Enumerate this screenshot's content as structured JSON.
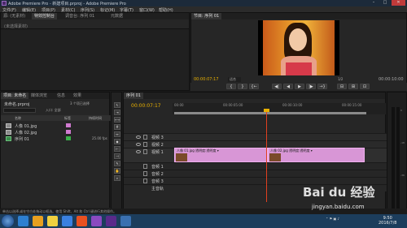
{
  "window": {
    "title": "Adobe Premiere Pro - 新建项目.prproj - Adobe Premiere Pro"
  },
  "menu": [
    "文件(F)",
    "编辑(E)",
    "项目(P)",
    "素材(C)",
    "序列(S)",
    "标记(M)",
    "字幕(T)",
    "窗口(W)",
    "帮助(H)"
  ],
  "source": {
    "tabs": [
      "源: (无素材)",
      "特效控制台",
      "调音台: 序列 01",
      "元数据"
    ],
    "empty_label": "(未选择素材)"
  },
  "program": {
    "tab": "节目: 序列 01",
    "timecode": "00:00:07:17",
    "fit": "适合",
    "fraction": "1/2",
    "duration": "00:00:10:00",
    "controls": [
      "{",
      "}",
      "{←",
      "◀|",
      "◀",
      "▶",
      "|▶",
      "→}",
      "⊟",
      "⊞",
      "⊡"
    ]
  },
  "project": {
    "tabs": [
      "项目: 未命名",
      "媒体浏览",
      "信息",
      "效果"
    ],
    "file": "未命名.prproj",
    "count": "3 个项已选择",
    "entry_label": "入口: 全部",
    "columns": [
      "名称",
      "标签",
      "持续时间"
    ],
    "items": [
      {
        "name": "人像 01.jpg",
        "type": "image",
        "label_color": "#d07ad0",
        "duration": ""
      },
      {
        "name": "人像 02.jpg",
        "type": "image",
        "label_color": "#d07ad0",
        "duration": ""
      },
      {
        "name": "序列 01",
        "type": "sequence",
        "label_color": "#3ab04a",
        "duration": "25.00 fps"
      }
    ]
  },
  "timeline": {
    "tab": "序列 01",
    "timecode": "00:00:07:17",
    "ruler": [
      "00:00",
      "00:00:05:00",
      "00:00:10:00",
      "00:00:15:00"
    ],
    "tracks": [
      {
        "name": "视频 3",
        "kind": "video"
      },
      {
        "name": "视频 2",
        "kind": "video"
      },
      {
        "name": "视频 1",
        "kind": "video1"
      },
      {
        "name": "音频 1",
        "kind": "audio"
      },
      {
        "name": "音频 2",
        "kind": "audio"
      },
      {
        "name": "音频 3",
        "kind": "audio"
      },
      {
        "name": "主音轨",
        "kind": "audio"
      }
    ],
    "clips": [
      {
        "name": "人像 01.jpg 透明度:透明度 ▾"
      },
      {
        "name": "人像 02.jpg 透明度:透明度 ▾"
      }
    ]
  },
  "status": "单击以选择,或在空白处拖动以框选。使用 Shift、Alt 和 Ctrl 键进行其他操作。",
  "taskbar": {
    "time": "9:50",
    "date": "2016/7/8",
    "icons_colors": [
      "#2d7fd0",
      "#e8a020",
      "#f0d040",
      "#3a80e0",
      "#e85020",
      "#8a4ac0",
      "#5a2a8a",
      "#3a70b0"
    ]
  },
  "watermark": {
    "logo": "Bai du 经验",
    "url": "jingyan.baidu.com"
  }
}
